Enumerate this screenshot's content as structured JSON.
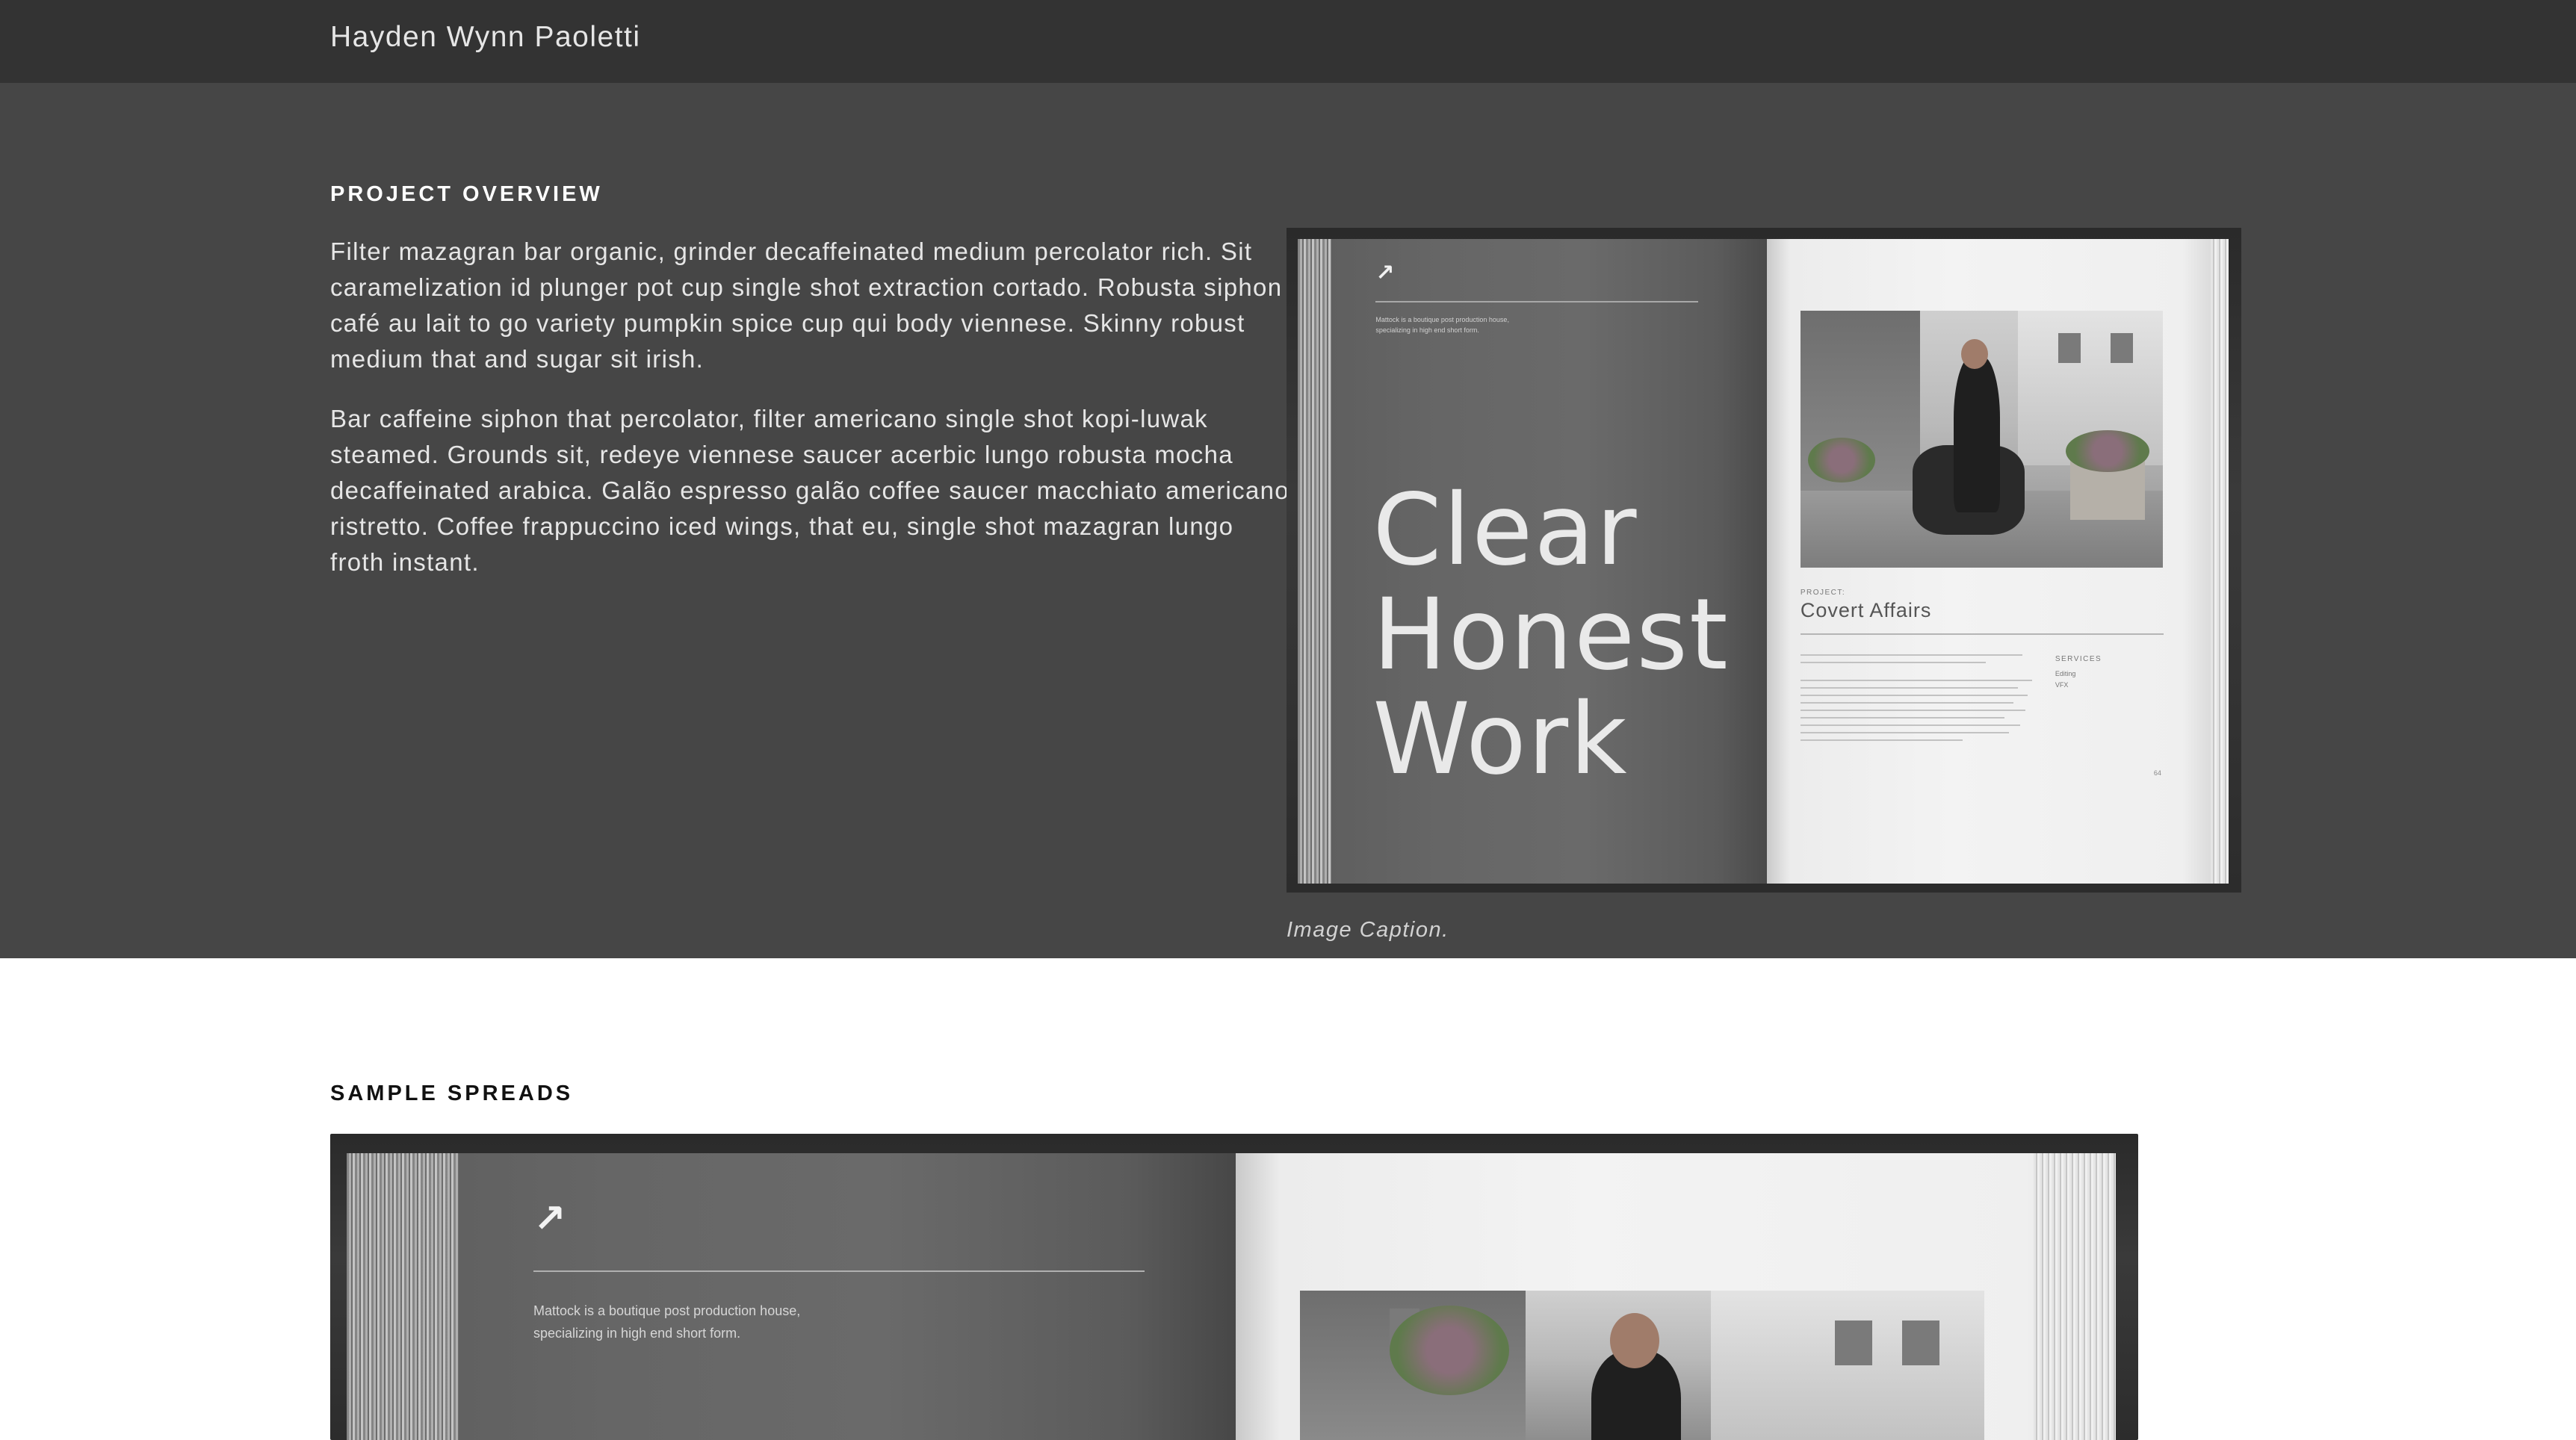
{
  "header": {
    "site_title": "Hayden Wynn Paoletti"
  },
  "overview": {
    "heading": "PROJECT OVERVIEW",
    "paragraphs": [
      "Filter mazagran bar organic, grinder decaffeinated medium percolator rich. Sit caramelization id plunger pot cup single shot extraction cortado. Robusta siphon café au lait to go variety pumpkin spice cup qui body viennese. Skinny robust medium that and sugar sit irish.",
      "Bar caffeine siphon that percolator, filter americano single shot kopi-luwak steamed. Grounds sit, redeye viennese saucer acerbic lungo robusta mocha decaffeinated arabica. Galão espresso galão coffee saucer macchiato americano ristretto. Coffee frappuccino iced wings, that eu, single shot mazagran lungo froth instant."
    ],
    "book": {
      "tagline_line1": "Mattock is a boutique post production house,",
      "tagline_line2": "specializing in high end short form.",
      "title_line1": "Clear",
      "title_line2": "Honest",
      "title_line3": "Work",
      "project_label": "PROJECT:",
      "project_name": "Covert Affairs",
      "services_label": "SERVICES",
      "service_1": "Editing",
      "service_2": "VFX",
      "page_number": "64",
      "logo_icon": "mattock-logo-icon"
    },
    "caption": "Image Caption."
  },
  "spreads": {
    "heading": "SAMPLE SPREADS",
    "book": {
      "tagline_line1": "Mattock is a boutique post production house,",
      "tagline_line2": "specializing in high end short form.",
      "logo_icon": "mattock-logo-icon"
    }
  },
  "colors": {
    "topbar": "#333333",
    "overview_bg": "#464646",
    "page_bg": "#ffffff"
  }
}
